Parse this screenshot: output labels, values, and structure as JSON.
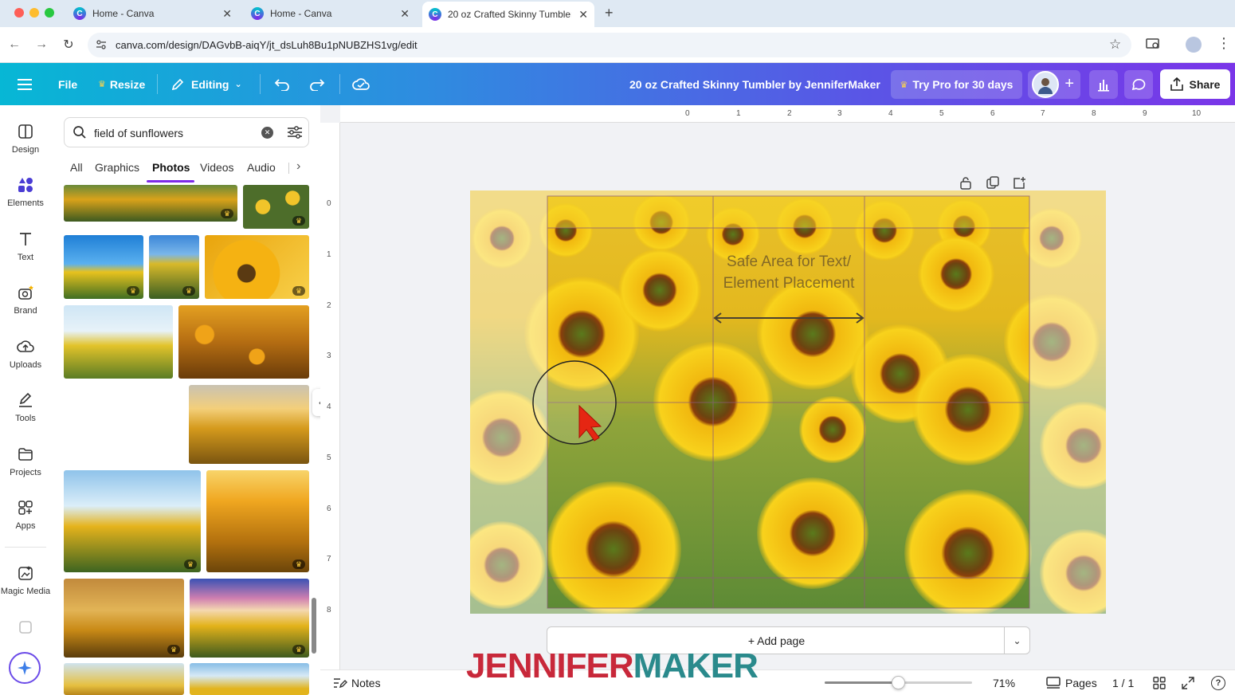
{
  "browser": {
    "tabs": [
      {
        "title": "Home - Canva"
      },
      {
        "title": "Home - Canva"
      },
      {
        "title": "20 oz Crafted Skinny Tumbler"
      }
    ],
    "url": "canva.com/design/DAGvbB-aiqY/jt_dsLuh8Bu1pNUBZHS1vg/edit"
  },
  "header": {
    "file": "File",
    "resize": "Resize",
    "editing": "Editing",
    "doc_title": "20 oz Crafted Skinny Tumbler by JenniferMaker",
    "try_pro": "Try Pro for 30 days",
    "share": "Share"
  },
  "rail": {
    "items": [
      {
        "label": "Design",
        "icon": "design-icon"
      },
      {
        "label": "Elements",
        "icon": "elements-icon"
      },
      {
        "label": "Text",
        "icon": "text-icon"
      },
      {
        "label": "Brand",
        "icon": "brand-icon"
      },
      {
        "label": "Uploads",
        "icon": "upload-cloud-icon"
      },
      {
        "label": "Tools",
        "icon": "tools-icon"
      },
      {
        "label": "Projects",
        "icon": "folder-icon"
      },
      {
        "label": "Apps",
        "icon": "apps-icon"
      },
      {
        "label": "Magic Media",
        "icon": "magic-media-icon"
      }
    ]
  },
  "panel": {
    "search_value": "field of sunflowers",
    "tabs": [
      "All",
      "Graphics",
      "Photos",
      "Videos",
      "Audio"
    ],
    "active_tab": "Photos"
  },
  "canvas": {
    "safe_area_line1": "Safe Area for Text/",
    "safe_area_line2": "Element Placement",
    "hruler": [
      "0",
      "1",
      "2",
      "3",
      "4",
      "5",
      "6",
      "7",
      "8",
      "9",
      "10"
    ],
    "vruler": [
      "0",
      "1",
      "2",
      "3",
      "4",
      "5",
      "6",
      "7",
      "8"
    ],
    "add_page": "+ Add page"
  },
  "footer": {
    "notes": "Notes",
    "zoom": "71%",
    "zoom_fraction": 0.71,
    "pages": "Pages",
    "page_count": "1 / 1"
  },
  "watermark": {
    "part1": "JENNIFER",
    "part2": "MAKER",
    "color1": "#c8283a",
    "color2": "#2a8a8c"
  },
  "colors": {
    "accent": "#7d2ae8",
    "header_start": "#07b7d5",
    "header_end": "#7a35e8"
  }
}
